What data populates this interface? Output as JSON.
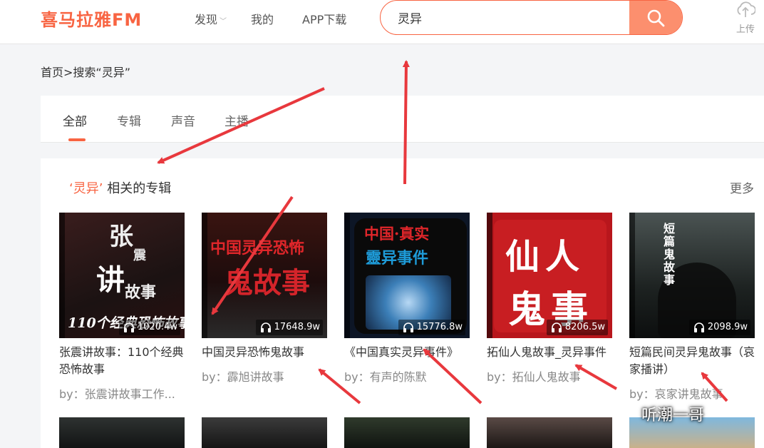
{
  "header": {
    "logo": "喜马拉雅FM",
    "nav": {
      "discover": "发现",
      "mine": "我的",
      "app": "APP下载"
    },
    "search_value": "灵异",
    "upload": "上传"
  },
  "breadcrumb": {
    "home": "首页",
    "sep": ">",
    "current": "搜索“灵异”"
  },
  "tabs": {
    "all": "全部",
    "album": "专辑",
    "sound": "声音",
    "anchor": "主播"
  },
  "section": {
    "quote_open": "‘",
    "keyword": "灵异",
    "quote_close": "’",
    "suffix": "相关的专辑",
    "more": "更多"
  },
  "albums": [
    {
      "title": "张震讲故事：110个经典恐怖故事",
      "author": "by：张震讲故事工作...",
      "plays": "1020.4w",
      "cover_text": [
        "张",
        "震",
        "讲",
        "故事",
        "110个经典恐怖故事"
      ]
    },
    {
      "title": "中国灵异恐怖鬼故事",
      "author": "by：霹旭讲故事",
      "plays": "17648.9w",
      "cover_text": [
        "中国灵异恐怖",
        "鬼故事"
      ]
    },
    {
      "title": "《中国真实灵异事件》",
      "author": "by：有声的陈默",
      "plays": "15776.8w",
      "cover_text": [
        "中国·真实",
        "靈异事件"
      ]
    },
    {
      "title": "拓仙人鬼故事_灵异事件",
      "author": "by：拓仙人鬼故事",
      "plays": "8206.5w",
      "cover_text": [
        "仙人",
        "鬼事"
      ]
    },
    {
      "title": "短篇民间灵异鬼故事（哀家播讲）",
      "author": "by：哀家讲鬼故事",
      "plays": "2098.9w",
      "cover_text": [
        "短篇鬼故事"
      ]
    }
  ],
  "watermark": "听潮一哥",
  "colors": {
    "accent": "#f86442",
    "search_button": "#fc8f6e",
    "arrow": "#e8383d"
  }
}
